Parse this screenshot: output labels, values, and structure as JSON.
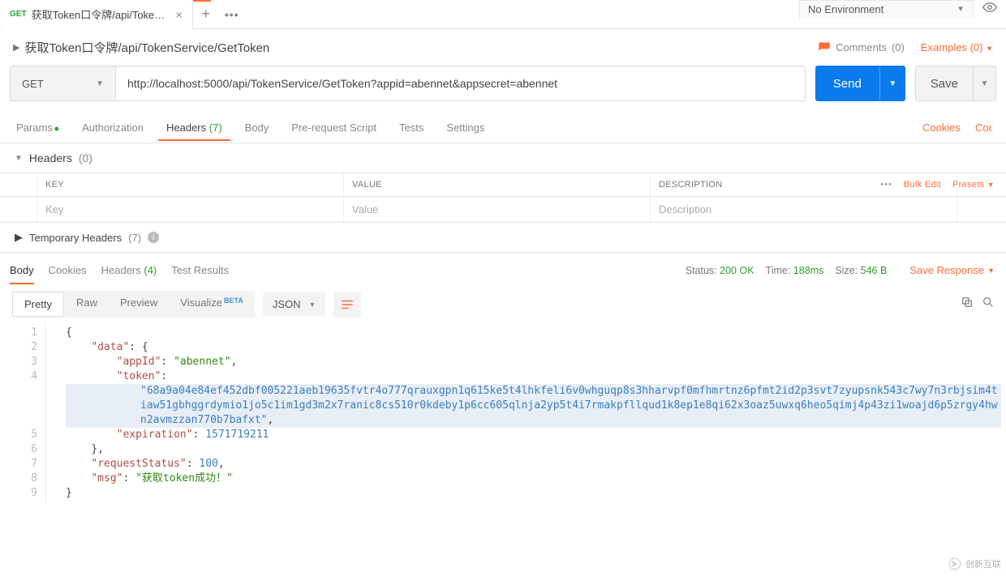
{
  "environment": {
    "selected": "No Environment"
  },
  "tab": {
    "method": "GET",
    "title": "获取Token口令牌/api/TokenSer..."
  },
  "breadcrumb": "获取Token口令牌/api/TokenService/GetToken",
  "rightLinks": {
    "comments_label": "Comments",
    "comments_count": "(0)",
    "examples_label": "Examples",
    "examples_count": "(0)"
  },
  "request": {
    "method": "GET",
    "url": "http://localhost:5000/api/TokenService/GetToken?appid=abennet&appsecret=abennet",
    "send": "Send",
    "save": "Save"
  },
  "reqTabs": {
    "params": "Params",
    "authorization": "Authorization",
    "headers": "Headers",
    "headers_count": "(7)",
    "body": "Body",
    "prerequest": "Pre-request Script",
    "tests": "Tests",
    "settings": "Settings",
    "cookies": "Cookies",
    "code": "Code"
  },
  "headersSection": {
    "title": "Headers",
    "count": "(0)",
    "cols": {
      "key": "KEY",
      "value": "VALUE",
      "description": "DESCRIPTION"
    },
    "placeholders": {
      "key": "Key",
      "value": "Value",
      "description": "Description"
    },
    "bulkEdit": "Bulk Edit",
    "presets": "Presets"
  },
  "tempHeaders": {
    "title": "Temporary Headers",
    "count": "(7)"
  },
  "respTabs": {
    "body": "Body",
    "cookies": "Cookies",
    "headers": "Headers",
    "headers_count": "(4)",
    "testResults": "Test Results"
  },
  "respMeta": {
    "status_label": "Status:",
    "status_value": "200 OK",
    "time_label": "Time:",
    "time_value": "188ms",
    "size_label": "Size:",
    "size_value": "546 B",
    "save_response": "Save Response"
  },
  "viewBar": {
    "pretty": "Pretty",
    "raw": "Raw",
    "preview": "Preview",
    "visualize": "Visualize",
    "beta": "BETA",
    "format": "JSON"
  },
  "responseJson": {
    "keys": {
      "data": "\"data\"",
      "appId": "\"appId\"",
      "token": "\"token\"",
      "expiration": "\"expiration\"",
      "requestStatus": "\"requestStatus\"",
      "msg": "\"msg\""
    },
    "values": {
      "appId": "\"abennet\"",
      "token": "\"68a9a04e84ef452dbf005221aeb19635fvtr4o777qrauxgpn1q615ke5t4lhkfeli6v0whguqp8s3hharvpf0mfhmrtnz6pfmt2id2p3svt7zyupsnk543c7wy7n3rbjsim4tiaw51gbhggrdymio1jo5c1im1gd3m2x7ranic8cs510r0kdeby1p6cc605qlnja2yp5t4i7rmakpfllqud1k8ep1e8qi62x3oaz5uwxq6heo5qimj4p43zi1woajd6p5zrgy4hwn2avmzzan770b7bafxt\"",
      "expiration": "1571719211",
      "requestStatus": "100",
      "msg": "\"获取token成功！\""
    }
  },
  "gutter": [
    "1",
    "2",
    "3",
    "4",
    "",
    "",
    "",
    "5",
    "6",
    "7",
    "8",
    "9"
  ],
  "watermark": "创新互联"
}
